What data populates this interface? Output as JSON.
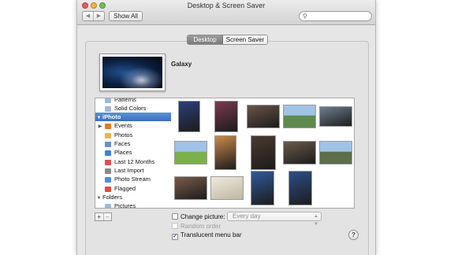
{
  "window": {
    "title": "Desktop & Screen Saver"
  },
  "toolbar": {
    "back": "◀",
    "forward": "▶",
    "show_all": "Show All",
    "search_placeholder": ""
  },
  "tabs": [
    {
      "label": "Desktop",
      "active": true
    },
    {
      "label": "Screen Saver",
      "active": false
    }
  ],
  "current": {
    "name": "Galaxy"
  },
  "sidebar": {
    "items": [
      {
        "label": "Patterns",
        "icon": "folder-icon",
        "color": "#9fb9d8"
      },
      {
        "label": "Solid Colors",
        "icon": "folder-icon",
        "color": "#9fb9d8"
      },
      {
        "label": "iPhoto",
        "section": true,
        "expanded": true
      },
      {
        "label": "Events",
        "icon": "events-icon",
        "color": "#e07a2e",
        "disclosure": "▶"
      },
      {
        "label": "Photos",
        "icon": "photos-icon",
        "color": "#e8b54a"
      },
      {
        "label": "Faces",
        "icon": "faces-icon",
        "color": "#6a8fc4"
      },
      {
        "label": "Places",
        "icon": "places-icon",
        "color": "#3f83c9"
      },
      {
        "label": "Last 12 Months",
        "icon": "calendar-icon",
        "color": "#d9534f"
      },
      {
        "label": "Last Import",
        "icon": "clock-icon",
        "color": "#8a8a8a"
      },
      {
        "label": "Photo Stream",
        "icon": "cloud-icon",
        "color": "#4a90d9"
      },
      {
        "label": "Flagged",
        "icon": "flag-icon",
        "color": "#e14b3b"
      },
      {
        "label": "Folders",
        "section_plain": true,
        "expanded": true
      },
      {
        "label": "Pictures",
        "icon": "folder-icon",
        "color": "#9fb9d8"
      }
    ]
  },
  "photos": [
    {
      "name": "photo-1",
      "color": "#2b3f7a"
    },
    {
      "name": "photo-2",
      "color": "#7a3a4e"
    },
    {
      "name": "photo-3",
      "color": "#6b5448"
    },
    {
      "name": "photo-4",
      "color": "#5f8a4d"
    },
    {
      "name": "photo-5",
      "color": "#6f7f8f"
    },
    {
      "name": "photo-6",
      "color": "#7bb04d"
    },
    {
      "name": "photo-7",
      "color": "#c98a4a"
    },
    {
      "name": "photo-8",
      "color": "#4a3a2f"
    },
    {
      "name": "photo-9",
      "color": "#6a5a4a"
    },
    {
      "name": "photo-10",
      "color": "#5c6f4a"
    },
    {
      "name": "photo-11",
      "color": "#7a5c4a"
    },
    {
      "name": "photo-12",
      "color": "#d8d2c0"
    },
    {
      "name": "photo-13",
      "color": "#2f5a9a"
    },
    {
      "name": "photo-14",
      "color": "#2c4f8a"
    }
  ],
  "options": {
    "change_picture": "Change picture:",
    "interval": "Every day",
    "random_order": "Random order",
    "translucent_menu_bar": "Translucent menu bar",
    "translucent_checked": true,
    "change_checked": false
  },
  "buttons": {
    "add": "+",
    "remove": "−",
    "help": "?"
  }
}
